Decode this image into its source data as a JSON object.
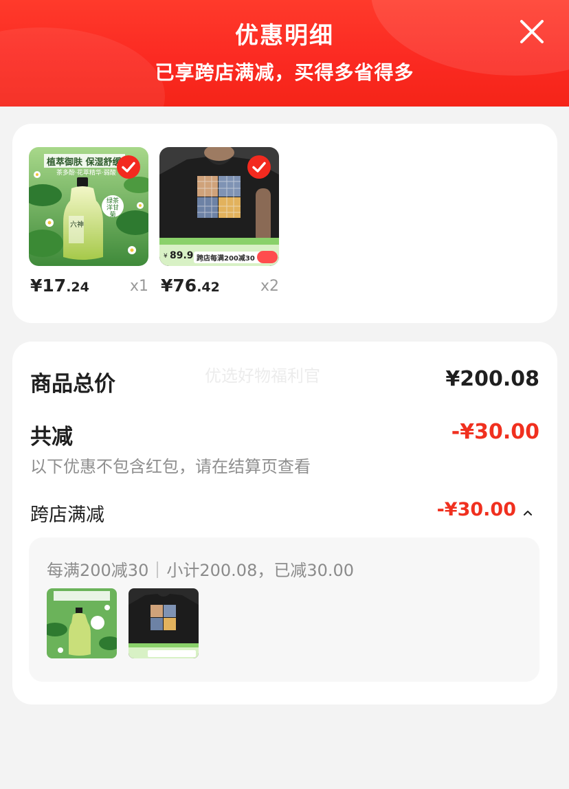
{
  "header": {
    "title": "优惠明细",
    "subtitle": "已享跨店满减，买得多省得多"
  },
  "products": [
    {
      "image_text_banner": "植萃御肤 保湿舒缓",
      "image_text_sub": "茶多酚·花萃精华·弱酸",
      "image_text_badge_1": "绿茶",
      "image_text_badge_2": "洋甘菊",
      "image_brand": "六神",
      "price_currency": "¥",
      "price_int": "17",
      "price_dec": ".24",
      "qty": "x1"
    },
    {
      "image_price_tag": "89.9",
      "image_price_currency": "¥",
      "image_promo": "跨店每满200减30",
      "price_currency": "¥",
      "price_int": "76",
      "price_dec": ".42",
      "qty": "x2"
    }
  ],
  "summary": {
    "total_label": "商品总价",
    "total_value": "¥200.08",
    "watermark": "优选好物福利官",
    "reduce_label": "共减",
    "reduce_value": "-¥30.00",
    "note": "以下优惠不包含红包，请在结算页查看",
    "cross_label": "跨店满减",
    "cross_value": "-¥30.00"
  },
  "detail": {
    "rule": "每满200减30",
    "subtotal": "小计200.08，已减30.00"
  },
  "colors": {
    "header_red": "#fb2a22",
    "accent_red": "#f0301f",
    "page_bg": "#f3f3f3"
  },
  "icons": [
    "close-icon",
    "check-icon",
    "chevron-up-icon"
  ]
}
